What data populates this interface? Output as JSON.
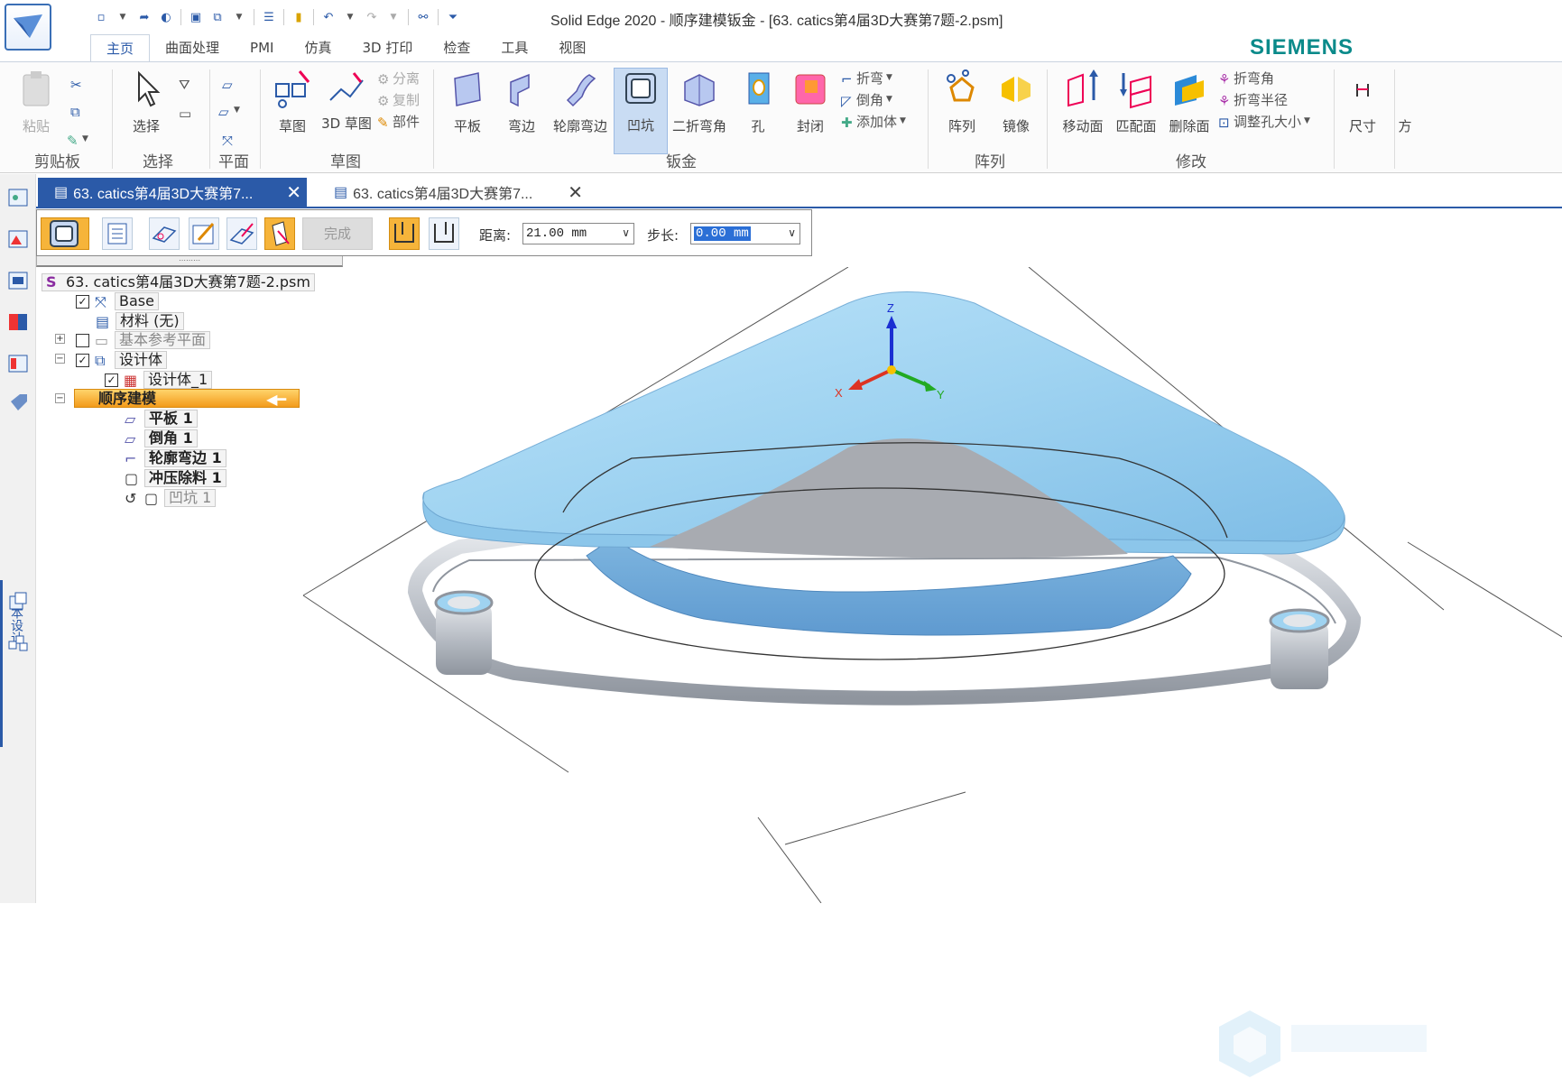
{
  "app": {
    "title": "Solid Edge 2020 - 顺序建模钣金 - [63. catics第4届3D大赛第7题-2.psm]",
    "brand": "SIEMENS",
    "brand_color": "#0a8a8a",
    "accent_color": "#2b5aa8"
  },
  "ribbon_tabs": [
    {
      "label": "主页",
      "active": true
    },
    {
      "label": "曲面处理"
    },
    {
      "label": "PMI"
    },
    {
      "label": "仿真"
    },
    {
      "label": "3D 打印"
    },
    {
      "label": "检查"
    },
    {
      "label": "工具"
    },
    {
      "label": "视图"
    }
  ],
  "ribbon": {
    "clipboard": {
      "paste": "粘贴",
      "group": "剪贴板"
    },
    "select": {
      "select": "选择",
      "group": "选择"
    },
    "plane": {
      "group": "平面"
    },
    "sketch": {
      "sketch": "草图",
      "sketch3d": "3D 草图",
      "group_3d": "草图",
      "split": "分离",
      "copy": "复制",
      "part": "部件"
    },
    "sheetmetal": {
      "tab": "平板",
      "flange": "弯边",
      "contour_flange": "轮廓弯边",
      "dimple": "凹坑",
      "double_bend": "二折弯角",
      "hole": "孔",
      "close": "封闭",
      "bend": "折弯",
      "chamfer": "倒角",
      "add_body": "添加体",
      "group": "钣金"
    },
    "pattern": {
      "pattern": "阵列",
      "mirror": "镜像",
      "group": "阵列"
    },
    "modify": {
      "move_face": "移动面",
      "match_face": "匹配面",
      "delete_face": "删除面",
      "bend_angle": "折弯角",
      "bend_radius": "折弯半径",
      "resize_hole": "调整孔大小",
      "group": "修改"
    },
    "dimension": {
      "label": "尺寸"
    },
    "cut_label": "方"
  },
  "left_strip": {
    "cost_design": "成本设计"
  },
  "doc_tabs": [
    {
      "label": "63. catics第4届3D大赛第7...",
      "active": true
    },
    {
      "label": "63. catics第4届3D大赛第7..."
    }
  ],
  "cmdbar": {
    "done": "完成",
    "distance_label": "距离:",
    "distance_value": "21.00 mm",
    "step_label": "步长:",
    "step_value": "0.00 mm"
  },
  "tree": {
    "root": "63. catics第4届3D大赛第7题-2.psm",
    "base": "Base",
    "material": "材料 (无)",
    "ref_planes": "基本参考平面",
    "design_body": "设计体",
    "design_body_1": "设计体_1",
    "sequential": "顺序建模",
    "features": [
      "平板 1",
      "倒角 1",
      "轮廓弯边 1",
      "冲压除料 1",
      "凹坑 1"
    ]
  },
  "viewport": {
    "axis_x": "X",
    "axis_y": "Y",
    "axis_z": "Z",
    "part_color": "#9fd3f1",
    "frame_color": "#b7bcc4"
  }
}
